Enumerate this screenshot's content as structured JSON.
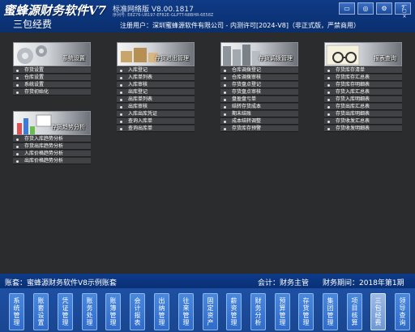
{
  "header": {
    "logo": "蜜蜂源财务软件V7",
    "version": "标准网络版 V8.00.1817",
    "serial": "序列号: E8Z76-U8197-EF82E-GLPTT-N8BHR-6E58Z",
    "module_title": "三包经费",
    "license": "注册用户：深圳蜜蜂源软件有限公司 - 内测许可[2024-V8]（非正式版，严禁商用）",
    "tool_icons": [
      "monitor-icon",
      "globe-icon",
      "settings-icon",
      "help-icon"
    ],
    "window_buttons": [
      "—",
      "▢",
      "×"
    ]
  },
  "groups": [
    {
      "title": "系统设置",
      "items": [
        "存货设置",
        "仓库设置",
        "系统设置",
        "存货初始化"
      ]
    },
    {
      "title": "存货进出管理",
      "items": [
        "入库登记",
        "入库单列表",
        "入库审核",
        "出库登记",
        "出库单列表",
        "出库审核",
        "入库出库凭证",
        "查询入库单",
        "查询出库单"
      ]
    },
    {
      "title": "存货调拨管理",
      "items": [
        "仓库调拨登记",
        "仓库调拨审核",
        "存货盘点登记",
        "存货盘点审核",
        "盘盈盘亏单",
        "结转存货成本",
        "期末结账",
        "成本结转调整",
        "存货库存预警"
      ]
    },
    {
      "title": "报表查询",
      "items": [
        "存货库存清单",
        "存货库存汇总表",
        "存货库存明细表",
        "存货入库汇总表",
        "存货入库明细表",
        "存货出库汇总表",
        "存货出库明细表",
        "存货收发汇总表",
        "存货收发明细表"
      ]
    },
    {
      "title": "存货趋势分析",
      "items": [
        "存货入库趋势分析",
        "存货出库趋势分析",
        "入库价格趋势分析",
        "出库价格趋势分析"
      ]
    }
  ],
  "status": {
    "account": "账套：蜜蜂源财务软件V8示例账套",
    "accountant": "会计：财务主管",
    "period": "财务期间：2018年第1期"
  },
  "nav": {
    "buttons": [
      "系统管理",
      "账套设置",
      "凭证管理",
      "账务处理",
      "账簿管理",
      "会计报表",
      "出纳管理",
      "往来管理",
      "固定资产",
      "薪资管理",
      "财务分析",
      "预算管理",
      "存货管理",
      "集团管理",
      "项目核算",
      "三包经费",
      "领导查询"
    ],
    "active_index": 15
  },
  "colors": {
    "header_bg": "#0f3a86",
    "body_bg": "#2b2c2e",
    "nav_button": "#3a7bd6",
    "active_nav": "#8aaedf"
  }
}
